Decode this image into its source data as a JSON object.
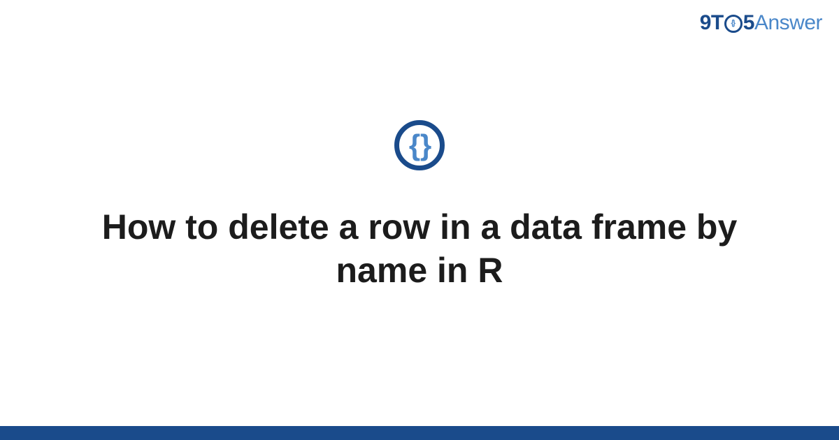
{
  "header": {
    "logo": {
      "part1": "9T",
      "part2": "5",
      "part3": "Answer",
      "inner_braces": "{}"
    }
  },
  "main": {
    "icon_braces": "{ }",
    "title": "How to delete a row in a data frame by name in R"
  },
  "colors": {
    "brand_dark": "#1a4b8b",
    "brand_light": "#4a87c9",
    "text": "#1c1c1c"
  }
}
